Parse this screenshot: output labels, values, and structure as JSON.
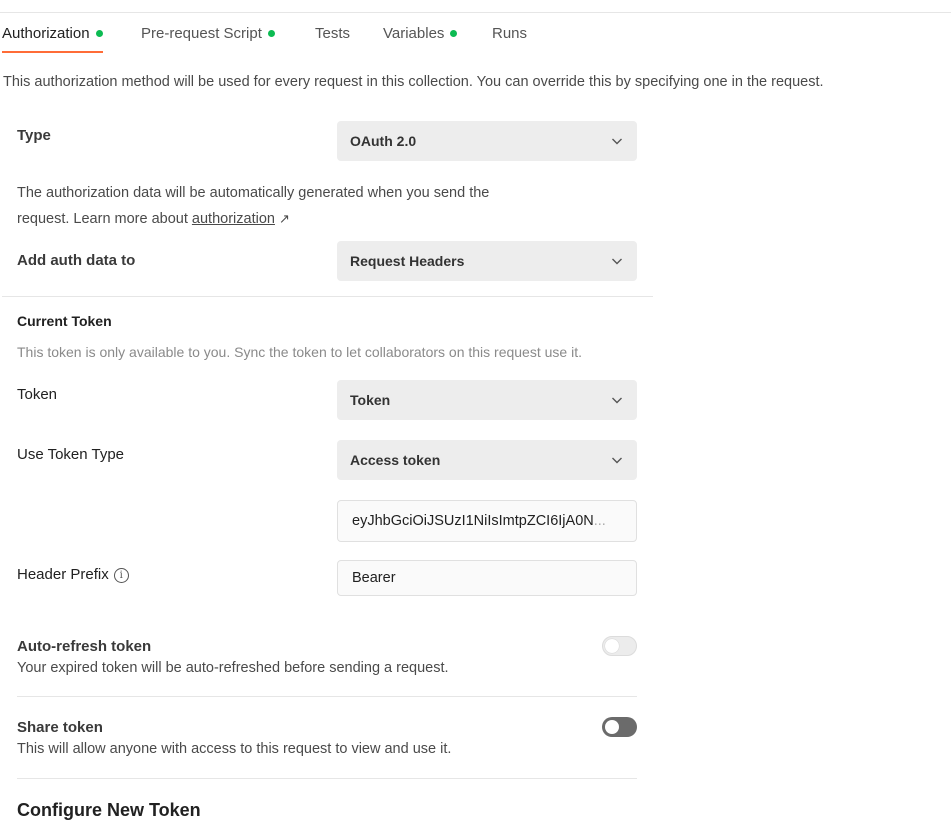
{
  "tabs": [
    {
      "label": "Authorization",
      "dot": true,
      "active": true
    },
    {
      "label": "Pre-request Script",
      "dot": true
    },
    {
      "label": "Tests",
      "dot": false
    },
    {
      "label": "Variables",
      "dot": true
    },
    {
      "label": "Runs",
      "dot": false
    }
  ],
  "intro": "This authorization method will be used for every request in this collection. You can override this by specifying one in the request.",
  "type": {
    "label": "Type",
    "value": "OAuth 2.0"
  },
  "auth_desc": {
    "line1": "The authorization data will be automatically generated when you send the",
    "line2_prefix": "request. Learn more about ",
    "link": "authorization",
    "arrow": "↗"
  },
  "add_auth": {
    "label": "Add auth data to",
    "value": "Request Headers"
  },
  "current_token": {
    "title": "Current Token",
    "note": "This token is only available to you. Sync the token to let collaborators on this request use it."
  },
  "token": {
    "label": "Token",
    "value": "Token"
  },
  "use_token_type": {
    "label": "Use Token Type",
    "value": "Access token"
  },
  "token_value": {
    "value": "eyJhbGciOiJSUzI1NiIsImtpZCI6IjA0N",
    "ellipsis": "..."
  },
  "header_prefix": {
    "label": "Header Prefix",
    "info_icon": "i",
    "value": "Bearer"
  },
  "auto_refresh": {
    "title": "Auto-refresh token",
    "desc": "Your expired token will be auto-refreshed before sending a request.",
    "enabled": false
  },
  "share_token": {
    "title": "Share token",
    "desc": "This will allow anyone with access to this request to view and use it.",
    "enabled": false
  },
  "configure": {
    "title": "Configure New Token"
  },
  "colors": {
    "accent": "#ff6c37",
    "dot": "#0cbb52"
  }
}
